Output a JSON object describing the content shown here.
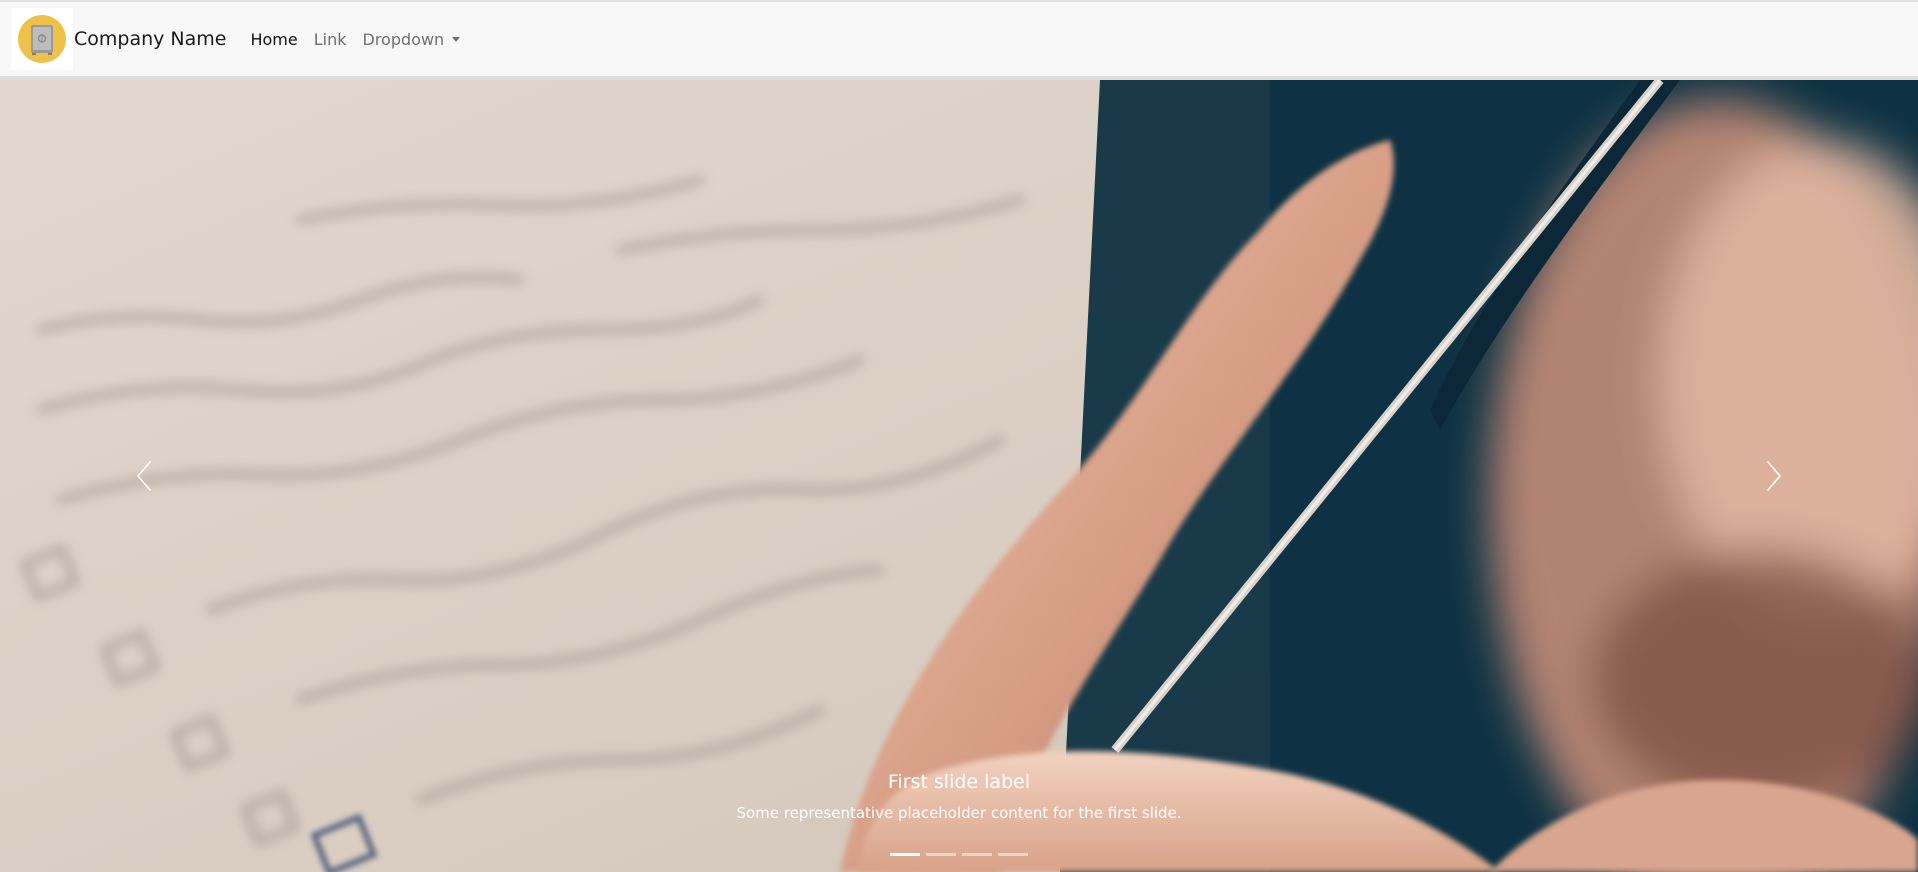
{
  "navbar": {
    "brand_name": "Company Name",
    "logo_icon": "safe-icon",
    "links": [
      {
        "label": "Home",
        "active": true
      },
      {
        "label": "Link",
        "active": false
      },
      {
        "label": "Dropdown",
        "active": false
      }
    ]
  },
  "carousel": {
    "caption_title": "First slide label",
    "caption_text": "Some representative placeholder content for the first slide.",
    "slide_count": 4,
    "active_slide": 1,
    "prev_icon": "chevron-left-icon",
    "next_icon": "chevron-right-icon"
  },
  "colors": {
    "navbar_bg": "#f8f8f8",
    "logo_circle": "#eec24a",
    "text_active": "#111111",
    "text_muted": "#6f6f6f"
  }
}
